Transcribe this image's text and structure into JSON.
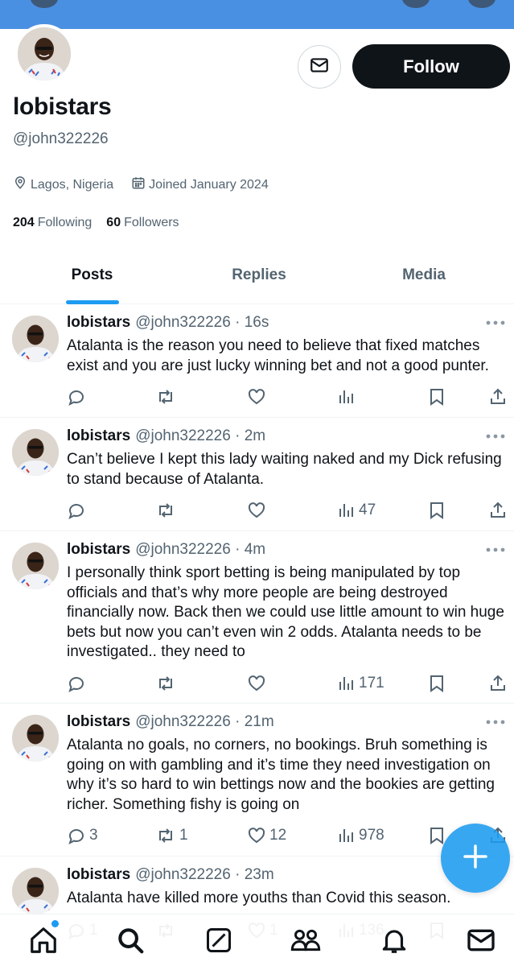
{
  "profile": {
    "display_name": "lobistars",
    "handle": "@john322226",
    "location": "Lagos, Nigeria",
    "joined": "Joined January 2024",
    "following_count": "204",
    "following_label": "Following",
    "followers_count": "60",
    "followers_label": "Followers",
    "follow_label": "Follow"
  },
  "tabs": [
    "Posts",
    "Replies",
    "Media"
  ],
  "active_tab": "Posts",
  "tweets": [
    {
      "name": "lobistars",
      "meta": "@john322226 · 16s",
      "text": "Atalanta is the reason you need to believe that fixed matches exist and you are just lucky winning bet and not a good punter.",
      "replies": "",
      "reposts": "",
      "likes": "",
      "views": ""
    },
    {
      "name": "lobistars",
      "meta": "@john322226 · 2m",
      "text": "Can’t believe I kept this lady waiting naked and my Dick refusing to stand because of Atalanta.",
      "replies": "",
      "reposts": "",
      "likes": "",
      "views": "47"
    },
    {
      "name": "lobistars",
      "meta": "@john322226 · 4m",
      "text": "I personally think sport betting is being manipulated by top officials and that’s why more people are being destroyed financially now. Back then we could use little amount to win huge bets but now you can’t even win 2 odds. Atalanta needs to be investigated.. they need to",
      "replies": "",
      "reposts": "",
      "likes": "",
      "views": "171"
    },
    {
      "name": "lobistars",
      "meta": "@john322226 · 21m",
      "text": "Atalanta no goals, no corners, no bookings. Bruh something is going on with gambling and it’s time they need investigation on why it’s so hard to win bettings now and the bookies are getting richer. Something fishy is going on",
      "replies": "3",
      "reposts": "1",
      "likes": "12",
      "views": "978"
    },
    {
      "name": "lobistars",
      "meta": "@john322226 · 23m",
      "text": "Atalanta have killed more youths than Covid this season.",
      "replies": "1",
      "reposts": "",
      "likes": "1",
      "views": "136"
    }
  ],
  "icons": {
    "location": "map-pin-icon",
    "calendar": "calendar-icon",
    "message": "envelope-icon",
    "compose": "plus-icon",
    "nav": [
      "home-icon",
      "search-icon",
      "grok-icon",
      "communities-icon",
      "notifications-icon",
      "messages-icon"
    ]
  },
  "colors": {
    "accent": "#1d9bf0",
    "text": "#0f1419",
    "muted": "#536471",
    "banner": "#4a90e2",
    "follow_bg": "#0f1419"
  }
}
